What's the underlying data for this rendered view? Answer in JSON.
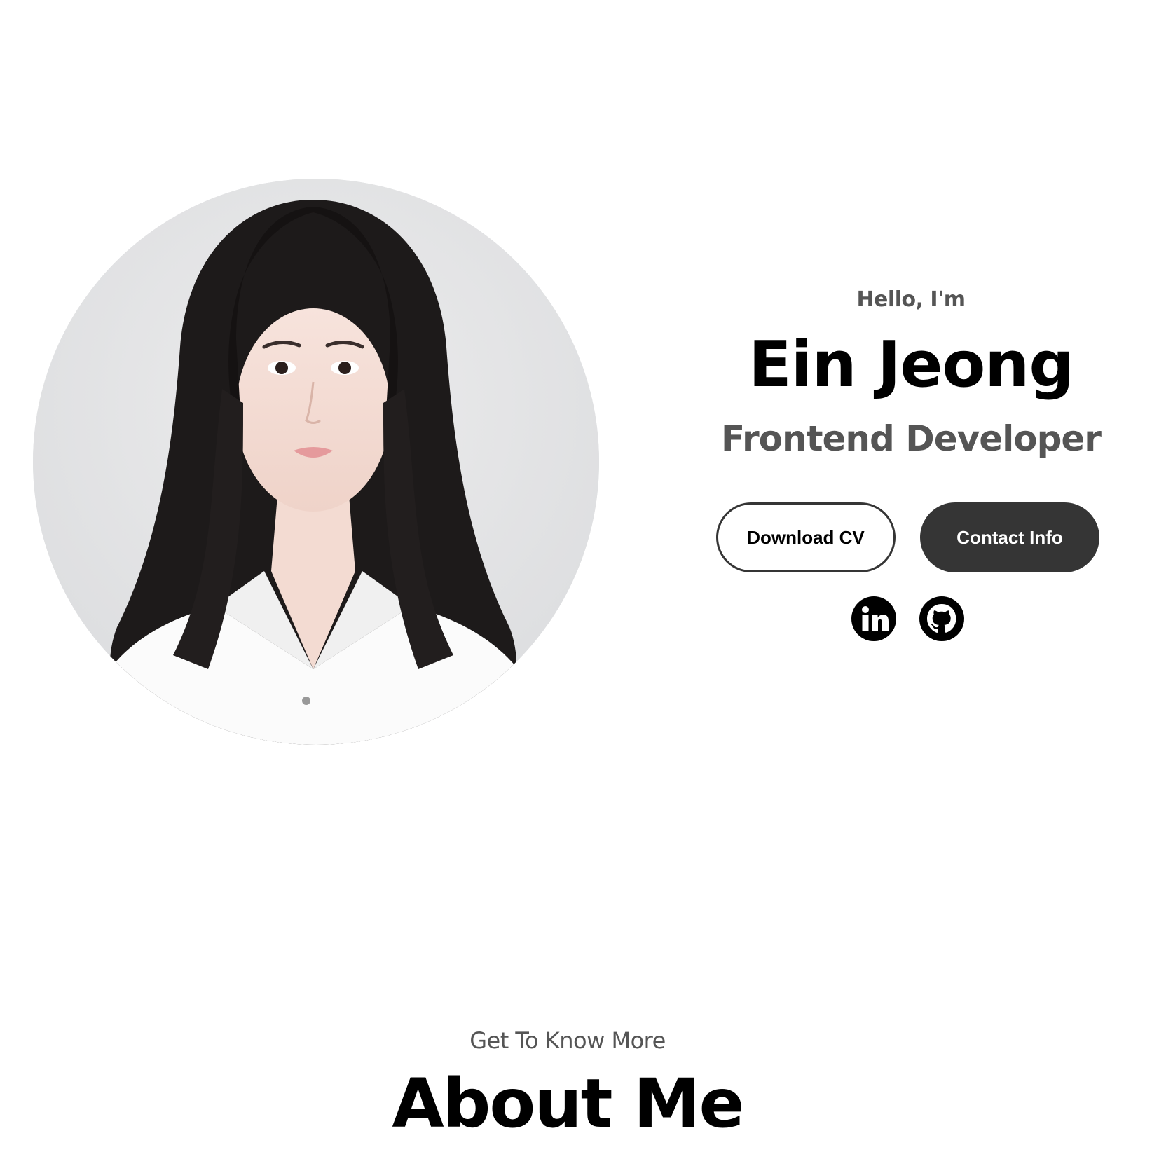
{
  "profile": {
    "image_alt": "profile-picture"
  },
  "hero": {
    "greeting": "Hello, I'm",
    "name": "Ein Jeong",
    "role": "Frontend Developer"
  },
  "buttons": {
    "download_cv": "Download CV",
    "contact_info": "Contact Info"
  },
  "socials": [
    {
      "icon": "linkedin-icon"
    },
    {
      "icon": "github-icon"
    }
  ],
  "about": {
    "subtitle": "Get To Know More",
    "title": "About Me"
  },
  "colors": {
    "text_primary": "#000000",
    "text_secondary": "#555555",
    "button_dark": "#353535",
    "background": "#ffffff"
  }
}
